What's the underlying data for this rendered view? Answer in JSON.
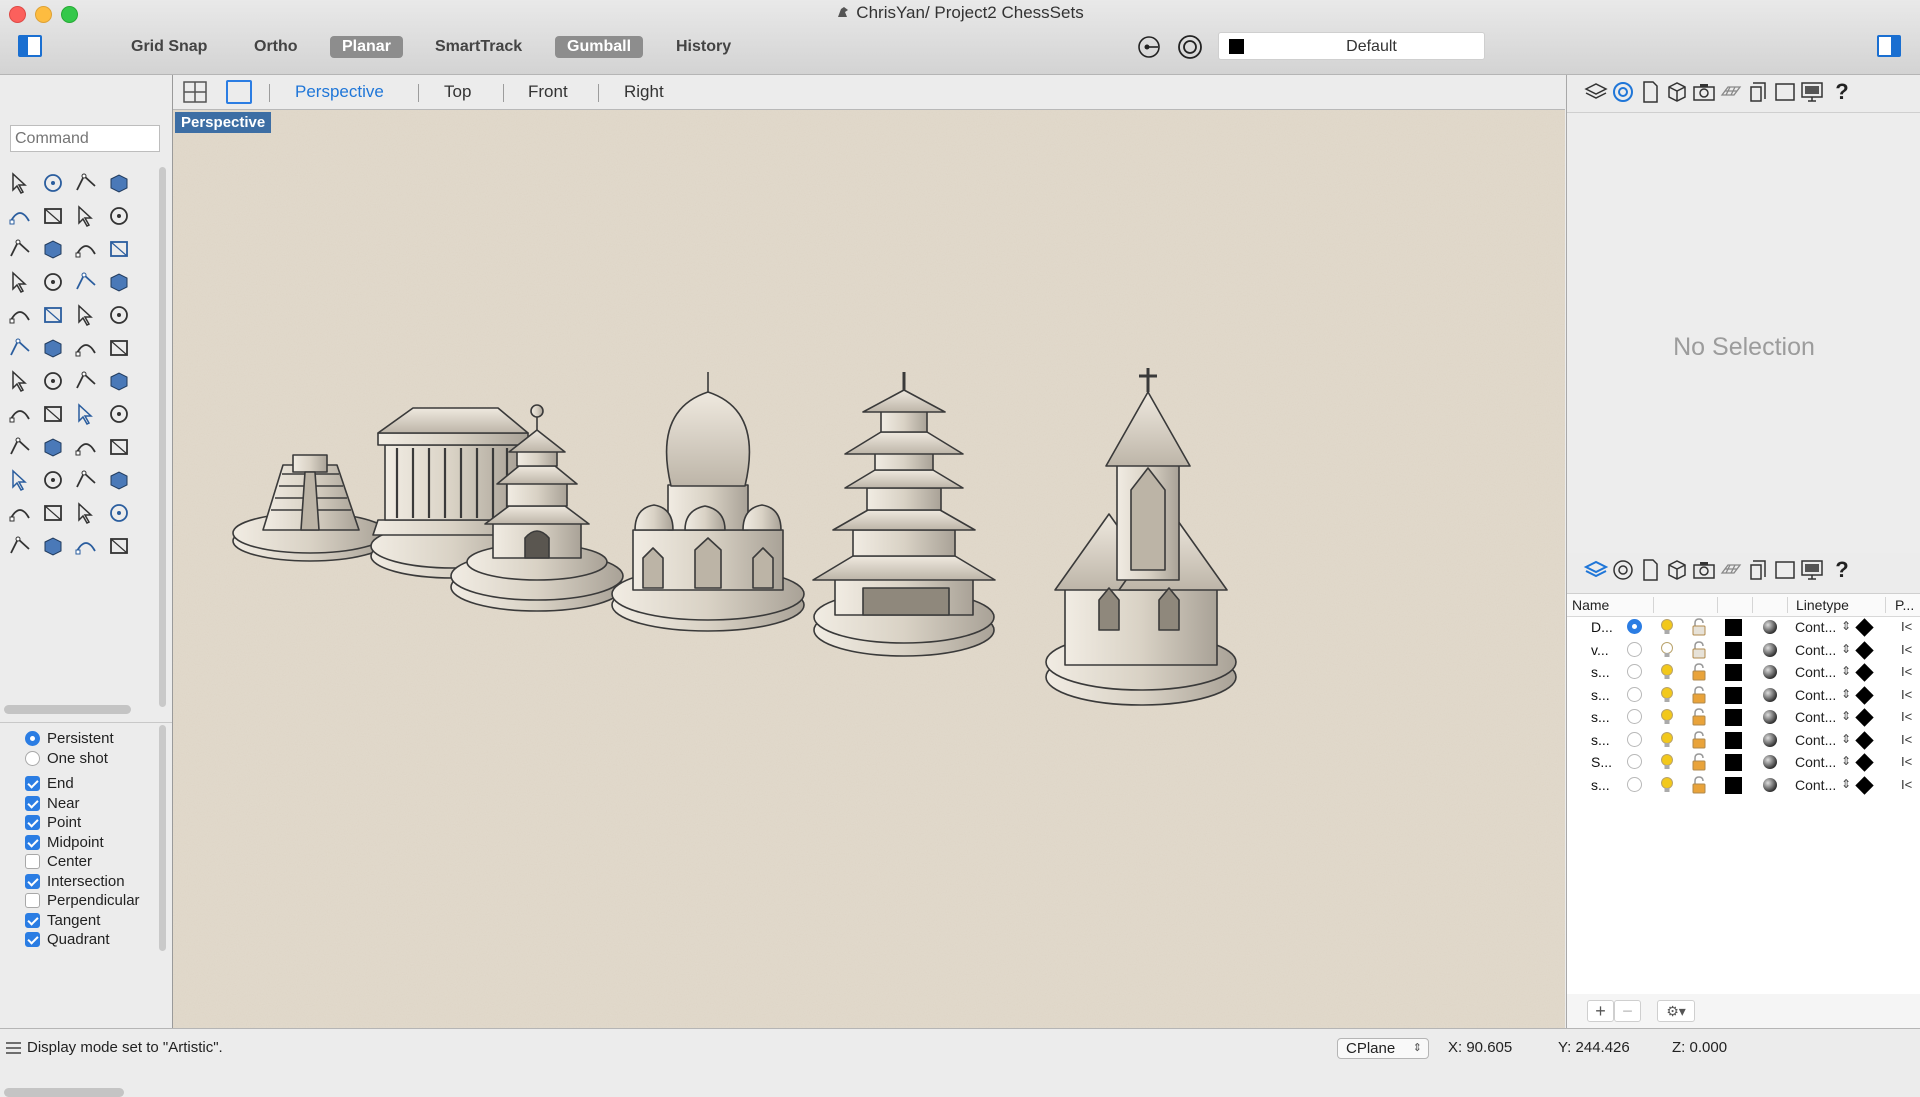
{
  "window": {
    "title": "ChrisYan/ Project2 ChessSets"
  },
  "toolbar": {
    "toggles": [
      {
        "label": "Grid Snap",
        "on": false
      },
      {
        "label": "Ortho",
        "on": false
      },
      {
        "label": "Planar",
        "on": true
      },
      {
        "label": "SmartTrack",
        "on": false
      },
      {
        "label": "Gumball",
        "on": true
      },
      {
        "label": "History",
        "on": false
      }
    ],
    "current_layer": "Default",
    "current_layer_color": "#000000"
  },
  "command": {
    "placeholder": "Command"
  },
  "viewport_tabs": {
    "tabs": [
      "Perspective",
      "Top",
      "Front",
      "Right"
    ],
    "active": "Perspective"
  },
  "viewport": {
    "label": "Perspective",
    "display_mode": "Artistic"
  },
  "osnap": {
    "modes": [
      {
        "label": "Persistent",
        "selected": true
      },
      {
        "label": "One shot",
        "selected": false
      }
    ],
    "snaps": [
      {
        "label": "End",
        "checked": true
      },
      {
        "label": "Near",
        "checked": true
      },
      {
        "label": "Point",
        "checked": true
      },
      {
        "label": "Midpoint",
        "checked": true
      },
      {
        "label": "Center",
        "checked": false
      },
      {
        "label": "Intersection",
        "checked": true
      },
      {
        "label": "Perpendicular",
        "checked": false
      },
      {
        "label": "Tangent",
        "checked": true
      },
      {
        "label": "Quadrant",
        "checked": true
      }
    ]
  },
  "properties": {
    "empty_text": "No Selection"
  },
  "layers": {
    "headers": {
      "name": "Name",
      "linetype": "Linetype",
      "print": "P..."
    },
    "rows": [
      {
        "name": "D...",
        "current": true,
        "on": true,
        "locked": false,
        "linetype": "Cont..."
      },
      {
        "name": "v...",
        "current": false,
        "on": false,
        "locked": false,
        "linetype": "Cont..."
      },
      {
        "name": "s...",
        "current": false,
        "on": true,
        "locked": true,
        "linetype": "Cont..."
      },
      {
        "name": "s...",
        "current": false,
        "on": true,
        "locked": true,
        "linetype": "Cont..."
      },
      {
        "name": "s...",
        "current": false,
        "on": true,
        "locked": true,
        "linetype": "Cont..."
      },
      {
        "name": "s...",
        "current": false,
        "on": true,
        "locked": true,
        "linetype": "Cont..."
      },
      {
        "name": "S...",
        "current": false,
        "on": true,
        "locked": true,
        "linetype": "Cont..."
      },
      {
        "name": "s...",
        "current": false,
        "on": true,
        "locked": true,
        "linetype": "Cont..."
      }
    ],
    "add_label": "+",
    "remove_label": "−"
  },
  "status": {
    "message": "Display mode set to \"Artistic\".",
    "cplane": "CPlane",
    "x": "X: 90.605",
    "y": "Y: 244.426",
    "z": "Z: 0.000"
  }
}
